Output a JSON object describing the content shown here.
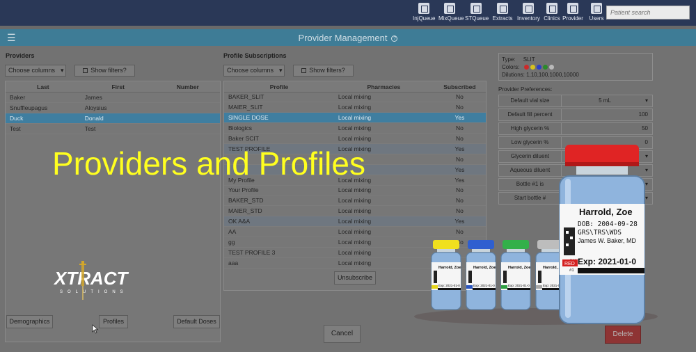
{
  "nav": {
    "items": [
      {
        "label": "InjQueue",
        "icon": "injection-queue-icon"
      },
      {
        "label": "MixQueue",
        "icon": "mix-queue-icon"
      },
      {
        "label": "STQueue",
        "icon": "skin-test-queue-icon"
      },
      {
        "label": "Extracts",
        "icon": "extracts-icon"
      },
      {
        "label": "Inventory",
        "icon": "inventory-icon"
      },
      {
        "label": "Clinics",
        "icon": "clinics-icon"
      },
      {
        "label": "Provider",
        "icon": "provider-icon"
      },
      {
        "label": "Users",
        "icon": "users-icon"
      }
    ],
    "search_placeholder": "Patient search"
  },
  "header": {
    "title": "Provider Management",
    "help": "?"
  },
  "providers": {
    "title": "Providers",
    "choose_columns": "Choose columns",
    "show_filters": "Show filters?",
    "columns": [
      "Last",
      "First",
      "Number"
    ],
    "rows": [
      {
        "last": "Baker",
        "first": "James",
        "number": ""
      },
      {
        "last": "Snuffleupagus",
        "first": "Aloysius",
        "number": ""
      },
      {
        "last": "Duck",
        "first": "Donald",
        "number": ""
      },
      {
        "last": "Test",
        "first": "Test",
        "number": ""
      }
    ],
    "selected_index": 2
  },
  "subscriptions": {
    "title": "Profile Subscriptions",
    "choose_columns": "Choose columns",
    "show_filters": "Show filters?",
    "columns": [
      "Profile",
      "Pharmacies",
      "Subscribed"
    ],
    "rows": [
      {
        "profile": "BAKER_SLIT",
        "pharmacy": "Local mixing",
        "subscribed": "No"
      },
      {
        "profile": "MAIER_SLIT",
        "pharmacy": "Local mixing",
        "subscribed": "No"
      },
      {
        "profile": "SINGLE DOSE",
        "pharmacy": "Local mixing",
        "subscribed": "Yes"
      },
      {
        "profile": "Biologics",
        "pharmacy": "Local mixing",
        "subscribed": "No"
      },
      {
        "profile": "Baker SCIT",
        "pharmacy": "Local mixing",
        "subscribed": "No"
      },
      {
        "profile": "TEST PROFILE",
        "pharmacy": "Local mixing",
        "subscribed": "Yes"
      },
      {
        "profile": "",
        "pharmacy": "",
        "subscribed": "No"
      },
      {
        "profile": "",
        "pharmacy": "",
        "subscribed": "Yes"
      },
      {
        "profile": "My Profile",
        "pharmacy": "Local mixing",
        "subscribed": "Yes"
      },
      {
        "profile": "Your Profile",
        "pharmacy": "Local mixing",
        "subscribed": "No"
      },
      {
        "profile": "BAKER_STD",
        "pharmacy": "Local mixing",
        "subscribed": "No"
      },
      {
        "profile": "MAIER_STD",
        "pharmacy": "Local mixing",
        "subscribed": "No"
      },
      {
        "profile": "OK A&A",
        "pharmacy": "Local mixing",
        "subscribed": "Yes"
      },
      {
        "profile": "AA",
        "pharmacy": "Local mixing",
        "subscribed": "No"
      },
      {
        "profile": "gg",
        "pharmacy": "Local mixing",
        "subscribed": "No"
      },
      {
        "profile": "TEST PROFILE 3",
        "pharmacy": "Local mixing",
        "subscribed": ""
      },
      {
        "profile": "aaa",
        "pharmacy": "Local mixing",
        "subscribed": ""
      }
    ],
    "selected_index": 2,
    "highlighted": [
      5,
      7,
      12
    ],
    "unsubscribe_label": "Unsubscribe"
  },
  "profile_info": {
    "type_label": "Type:",
    "type_value": "SLIT",
    "colors_label": "Colors:",
    "colors": [
      "#cc2a2a",
      "#d6c21e",
      "#2a3fc4",
      "#2a8a2a",
      "#b9b9b9"
    ],
    "dilutions_label": "Dilutions:",
    "dilutions_value": "1,10,100,1000,10000"
  },
  "preferences": {
    "title": "Provider Preferences:",
    "rows": [
      {
        "label": "Default vial size",
        "value": "5 mL",
        "select": true
      },
      {
        "label": "Default fill percent",
        "value": "100",
        "select": false
      },
      {
        "label": "High glycerin %",
        "value": "50",
        "select": false
      },
      {
        "label": "Low glycerin %",
        "value": "0",
        "select": false
      },
      {
        "label": "Glycerin diluent",
        "value": "",
        "select": true
      },
      {
        "label": "Aqueous diluent",
        "value": "",
        "select": true
      },
      {
        "label": "Bottle #1 is",
        "value": "",
        "select": true
      },
      {
        "label": "Start bottle #",
        "value": "",
        "select": true
      }
    ]
  },
  "buttons": {
    "demographics": "Demographics",
    "profiles": "Profiles",
    "default_doses": "Default Doses",
    "cancel": "Cancel",
    "delete": "Delete"
  },
  "overlay": {
    "title": "Providers and Profiles"
  },
  "logo": {
    "text": "XTRACT",
    "subtitle": "SOLUTIONS"
  },
  "vials": {
    "large": {
      "name": "Harrold, Zoe",
      "dob": "DOB: 2004-09-28",
      "line3": "GRS\\TRS\\WDS",
      "doctor": "James W. Baker, MD",
      "color_label": "RED",
      "exp": "Exp: 2021-01-0",
      "only": "ONLY",
      "num": "#1"
    },
    "small": [
      {
        "cap": "#f0e01e",
        "band": "#e6d51a"
      },
      {
        "cap": "#2f5fd0",
        "band": "#2a55c0"
      },
      {
        "cap": "#33b04a",
        "band": "#2ea043"
      },
      {
        "cap": "#bdbdbd",
        "band": "#a8a8a8"
      }
    ],
    "small_name": "Harrold, Zoe",
    "small_exp": "Exp: 2021-01-0"
  }
}
